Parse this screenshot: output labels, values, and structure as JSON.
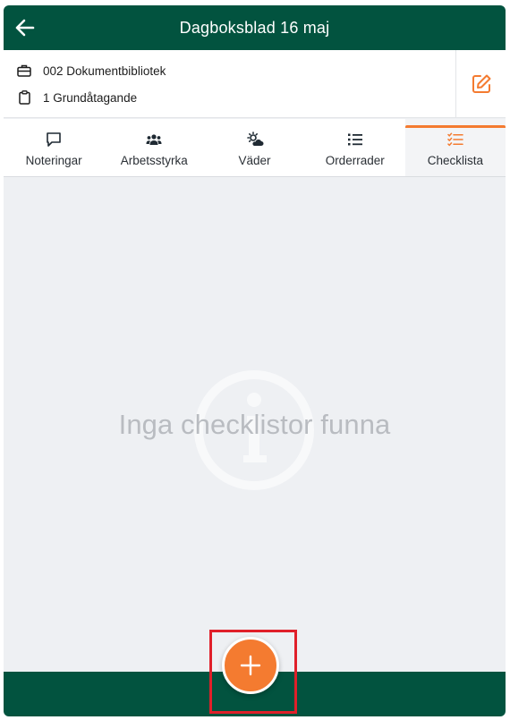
{
  "header": {
    "title": "Dagboksblad 16 maj",
    "back_icon": "arrow-left-icon"
  },
  "info": {
    "project": "002 Dokumentbibliotek",
    "project_icon": "briefcase-icon",
    "order": "1 Grundåtagande",
    "order_icon": "clipboard-icon",
    "edit_icon": "edit-icon"
  },
  "tabs": [
    {
      "label": "Noteringar",
      "icon": "comment-icon"
    },
    {
      "label": "Arbetsstyrka",
      "icon": "users-icon"
    },
    {
      "label": "Väder",
      "icon": "weather-icon"
    },
    {
      "label": "Orderrader",
      "icon": "list-icon"
    },
    {
      "label": "Checklista",
      "icon": "checklist-icon",
      "active": true
    }
  ],
  "empty_state": {
    "message": "Inga checklistor funna",
    "icon": "info-icon"
  },
  "fab": {
    "icon": "plus-icon"
  },
  "colors": {
    "primary": "#02533f",
    "accent": "#f47b30",
    "empty_text": "#b9bcc1",
    "highlight": "#e0202a"
  }
}
